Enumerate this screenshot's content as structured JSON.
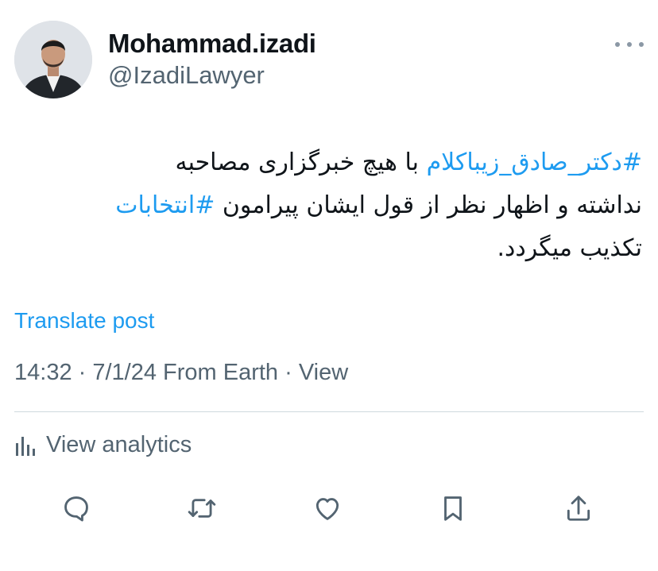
{
  "post": {
    "author_name": "Mohammad.izadi",
    "author_handle": "@IzadiLawyer",
    "text_lines": [
      {
        "tag": "#دکتر_صادق_زیباکلام",
        "rest": " با هیچ خبرگزاری مصاحبه"
      },
      {
        "before": "نداشته و اظهار نظر از قول ایشان پیرامون ",
        "tag": "#انتخابات"
      },
      {
        "text": "تکذیب میگردد."
      }
    ],
    "translate_label": "Translate post",
    "meta": "14:32 · 7/1/24 From Earth · View",
    "analytics_label": "View analytics"
  },
  "icons": {
    "more": "more-horizontal-icon",
    "analytics": "bar-chart-icon",
    "reply": "reply-icon",
    "repost": "repost-icon",
    "like": "heart-icon",
    "bookmark": "bookmark-icon",
    "share": "share-icon"
  },
  "colors": {
    "link": "#1d9bf0",
    "secondary_text": "#536471",
    "icon": "#536471",
    "divider": "#cfd9de"
  }
}
